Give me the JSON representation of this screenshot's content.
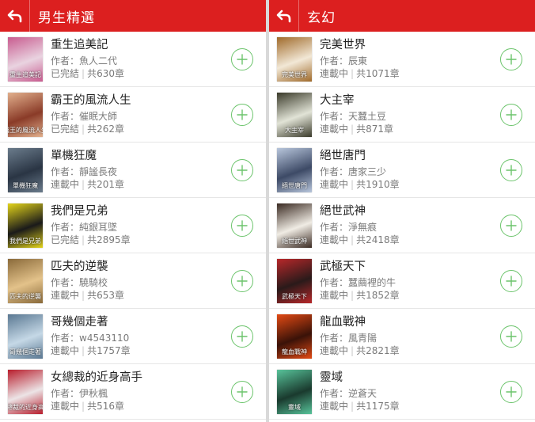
{
  "left": {
    "title": "男生精選",
    "books": [
      {
        "title": "重生追美記",
        "author": "作者：魚人二代",
        "status": "已完結",
        "chapters": "共630章",
        "cover_bg": "#e9d3e0",
        "cover_accent": "#c85b8f",
        "cover_text": "重生追美記"
      },
      {
        "title": "霸王的風流人生",
        "author": "作者：催眠大師",
        "status": "已完結",
        "chapters": "共262章",
        "cover_bg": "#8a3b28",
        "cover_accent": "#e2b08d",
        "cover_text": "霸王的風流人生"
      },
      {
        "title": "單機狂魔",
        "author": "作者：靜謐長夜",
        "status": "連載中",
        "chapters": "共201章",
        "cover_bg": "#2a3544",
        "cover_accent": "#6b7c8c",
        "cover_text": "單機狂魔"
      },
      {
        "title": "我們是兄弟",
        "author": "作者：純銀耳墜",
        "status": "已完結",
        "chapters": "共2895章",
        "cover_bg": "#1a1a1a",
        "cover_accent": "#e3d41a",
        "cover_text": "我們是兄弟"
      },
      {
        "title": "匹夫的逆襲",
        "author": "作者：驍騎校",
        "status": "連載中",
        "chapters": "共653章",
        "cover_bg": "#e3c28a",
        "cover_accent": "#8a6a3a",
        "cover_text": "匹夫的逆襲"
      },
      {
        "title": "哥幾個走著",
        "author": "作者：w4543110",
        "status": "連載中",
        "chapters": "共1757章",
        "cover_bg": "#c5d8e6",
        "cover_accent": "#5a7892",
        "cover_text": "哥幾個走著"
      },
      {
        "title": "女總裁的近身高手",
        "author": "作者：伊秋楓",
        "status": "連載中",
        "chapters": "共516章",
        "cover_bg": "#ece4e6",
        "cover_accent": "#b81d2c",
        "cover_text": "女總裁的近身高手"
      }
    ]
  },
  "right": {
    "title": "玄幻",
    "books": [
      {
        "title": "完美世界",
        "author": "作者：辰東",
        "status": "連載中",
        "chapters": "共1071章",
        "cover_bg": "#f2e8d6",
        "cover_accent": "#a06a2a",
        "cover_text": "完美世界"
      },
      {
        "title": "大主宰",
        "author": "作者：天蠶土豆",
        "status": "連載中",
        "chapters": "共871章",
        "cover_bg": "#e1e3d6",
        "cover_accent": "#3a3a2a",
        "cover_text": "大主宰"
      },
      {
        "title": "絕世唐門",
        "author": "作者：唐家三少",
        "status": "連載中",
        "chapters": "共1910章",
        "cover_bg": "#3d4a66",
        "cover_accent": "#b8c6dc",
        "cover_text": "絕世唐門"
      },
      {
        "title": "絕世武神",
        "author": "作者：淨無痕",
        "status": "連載中",
        "chapters": "共2418章",
        "cover_bg": "#f0ece4",
        "cover_accent": "#3a2a22",
        "cover_text": "絕世武神"
      },
      {
        "title": "武極天下",
        "author": "作者：蠶繭裡的牛",
        "status": "連載中",
        "chapters": "共1852章",
        "cover_bg": "#2a1a1a",
        "cover_accent": "#b8282a",
        "cover_text": "武極天下"
      },
      {
        "title": "龍血戰神",
        "author": "作者：風青陽",
        "status": "連載中",
        "chapters": "共2821章",
        "cover_bg": "#3a1208",
        "cover_accent": "#e24a14",
        "cover_text": "龍血戰神"
      },
      {
        "title": "靈域",
        "author": "作者：逆蒼天",
        "status": "連載中",
        "chapters": "共1175章",
        "cover_bg": "#1a3a2e",
        "cover_accent": "#58c39a",
        "cover_text": "靈域"
      }
    ]
  },
  "colors": {
    "header": "#dc1f1f",
    "add_button": "#6cc46c"
  },
  "icons": {
    "back": "back-arrow-icon",
    "add": "plus-icon"
  }
}
